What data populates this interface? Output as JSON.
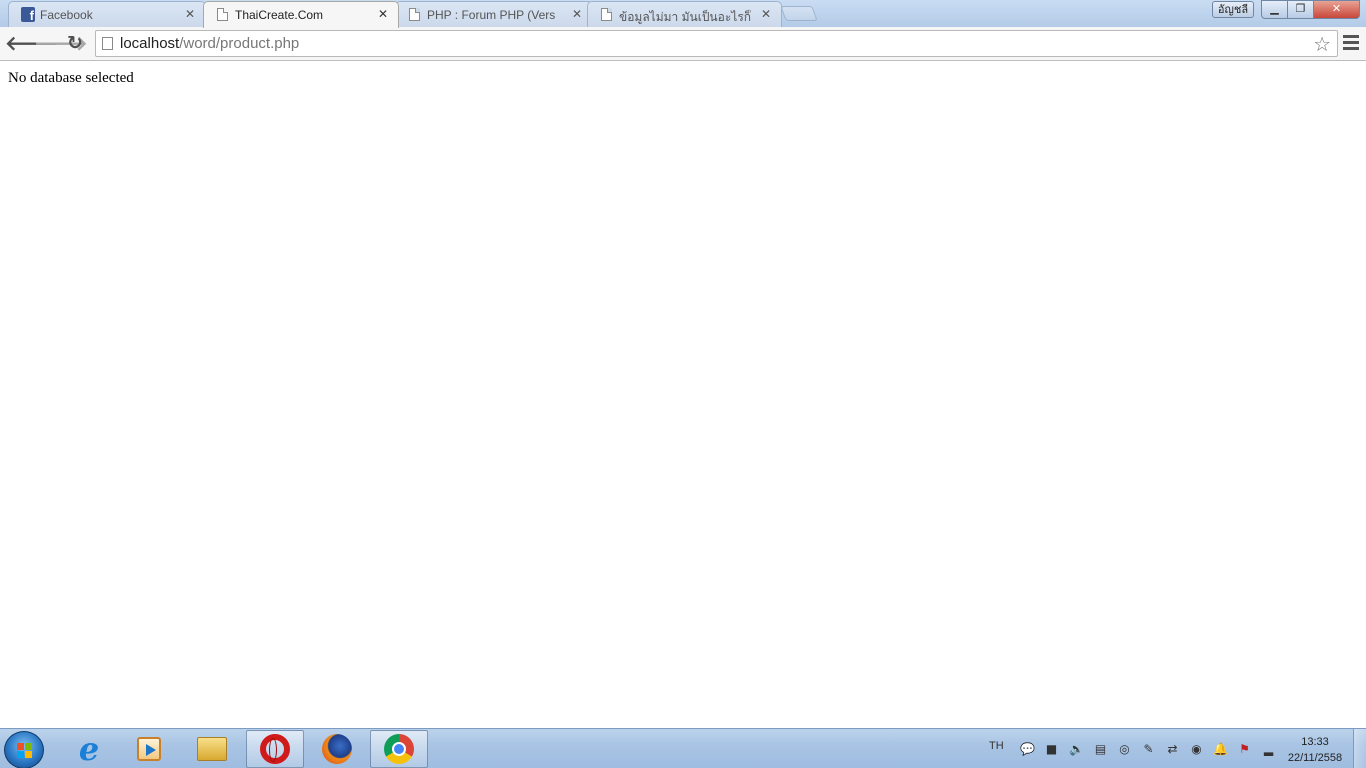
{
  "tabs": [
    {
      "title": "Facebook",
      "favicon": "facebook-icon",
      "active": false
    },
    {
      "title": "ThaiCreate.Com",
      "favicon": "page-icon",
      "active": true
    },
    {
      "title": "PHP : Forum PHP (Version",
      "favicon": "page-icon",
      "active": false
    },
    {
      "title": "ข้อมูลไม่มา มันเป็นอะไรก็ไม่รู้",
      "favicon": "page-icon",
      "active": false
    }
  ],
  "profile": {
    "label": "อัญชลี"
  },
  "toolbar": {
    "url_host": "localhost",
    "url_path": "/word/product.php"
  },
  "content": {
    "message": "No database selected"
  },
  "taskbar": {
    "apps": [
      "internet-explorer",
      "media-player",
      "file-explorer",
      "opera",
      "firefox",
      "chrome"
    ],
    "tray_language": "TH",
    "clock_time": "13:33",
    "clock_date": "22/11/2558"
  },
  "colors": {
    "facebook_blue": "#3b5998",
    "close_red": "#c8473a",
    "tabstrip_blue": "#b3cbe8"
  }
}
